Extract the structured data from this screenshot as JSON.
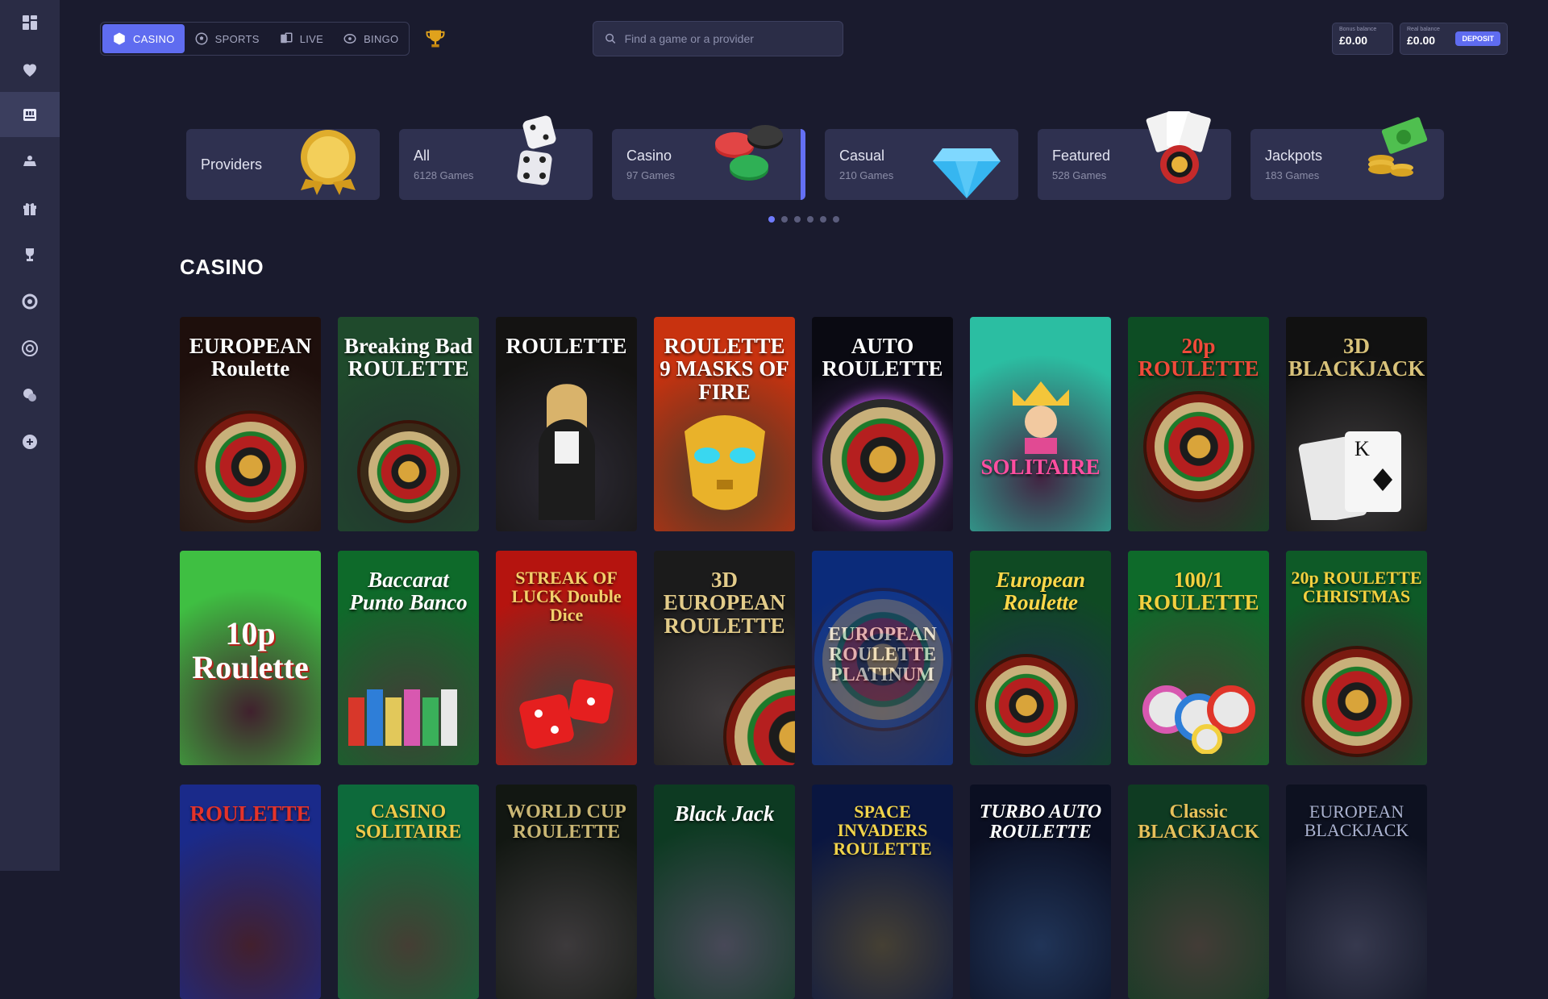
{
  "top_nav": {
    "modes": [
      {
        "label": "CASINO",
        "icon": "cube-icon",
        "active": true
      },
      {
        "label": "SPORTS",
        "icon": "soccer-ball-icon",
        "active": false
      },
      {
        "label": "LIVE",
        "icon": "live-cards-icon",
        "active": false
      },
      {
        "label": "BINGO",
        "icon": "bingo-ball-icon",
        "active": false
      }
    ],
    "trophy_icon": "trophy-icon"
  },
  "search": {
    "placeholder": "Find a game or a provider"
  },
  "balances": {
    "bonus_label": "Bonus balance",
    "bonus_amount": "£0.00",
    "real_label": "Real balance",
    "real_amount": "£0.00",
    "deposit_label": "DEPOSIT"
  },
  "sidebar": {
    "items": [
      {
        "icon": "dashboard-icon"
      },
      {
        "icon": "heart-icon"
      },
      {
        "icon": "casino-icon",
        "active": true
      },
      {
        "icon": "live-dealer-icon"
      },
      {
        "icon": "gift-icon"
      },
      {
        "icon": "trophy-icon"
      },
      {
        "icon": "settings-icon"
      },
      {
        "icon": "roulette-icon"
      },
      {
        "icon": "chat-icon"
      },
      {
        "icon": "support-icon"
      }
    ]
  },
  "categories": [
    {
      "title": "Providers",
      "subtitle": "",
      "icon": "medal-icon"
    },
    {
      "title": "All",
      "subtitle": "6128 Games",
      "icon": "dice-icon"
    },
    {
      "title": "Casino",
      "subtitle": "97 Games",
      "icon": "chips-icon",
      "active": true
    },
    {
      "title": "Casual",
      "subtitle": "210 Games",
      "icon": "diamond-icon"
    },
    {
      "title": "Featured",
      "subtitle": "528 Games",
      "icon": "cards-icon"
    },
    {
      "title": "Jackpots",
      "subtitle": "183 Games",
      "icon": "money-icon"
    }
  ],
  "carousel": {
    "pages": 6,
    "active_page": 1
  },
  "section": {
    "title": "CASINO"
  },
  "games": [
    {
      "name": "EUROPEAN Roulette",
      "bg": "#1e0f0c",
      "accent": "#c9921f"
    },
    {
      "name": "Breaking Bad ROULETTE",
      "bg": "#1f4a2c",
      "accent": "#4f8f3a"
    },
    {
      "name": "ROULETTE",
      "bg": "#141312",
      "accent": "#7a6a52"
    },
    {
      "name": "ROULETTE 9 MASKS OF FIRE",
      "bg": "#c8320f",
      "accent": "#f2b21a"
    },
    {
      "name": "AUTO ROULETTE",
      "bg": "#0a0a12",
      "accent": "#b04adb"
    },
    {
      "name": "SOLITAIRE",
      "bg": "#2bbea2",
      "accent": "#e14a93"
    },
    {
      "name": "20p ROULETTE",
      "bg": "#0d4d24",
      "accent": "#d23326"
    },
    {
      "name": "3D BLACKJACK",
      "bg": "#111111",
      "accent": "#c9b774"
    },
    {
      "name": "10p Roulette",
      "bg": "#3fbf42",
      "accent": "#d8372a"
    },
    {
      "name": "Baccarat Punto Banco",
      "bg": "#0e6a2a",
      "accent": "#e2c85a"
    },
    {
      "name": "STREAK OF LUCK Double Dice",
      "bg": "#b5140f",
      "accent": "#f3d06a"
    },
    {
      "name": "3D EUROPEAN ROULETTE",
      "bg": "#1b1b1b",
      "accent": "#d9c07a"
    },
    {
      "name": "EUROPEAN ROULETTE PLATINUM",
      "bg": "#0b2b7a",
      "accent": "#9fb3ff"
    },
    {
      "name": "European Roulette",
      "bg": "#0f4a23",
      "accent": "#3d66d6"
    },
    {
      "name": "100/1 ROULETTE",
      "bg": "#0e6a2a",
      "accent": "#f2d03f"
    },
    {
      "name": "20p ROULETTE CHRISTMAS",
      "bg": "#0e5a27",
      "accent": "#e0352a"
    },
    {
      "name": "ROULETTE",
      "bg": "#1a2a8a",
      "accent": "#e4332a"
    },
    {
      "name": "CASINO SOLITAIRE",
      "bg": "#0d6a3b",
      "accent": "#f0c94a"
    },
    {
      "name": "WORLD CUP ROULETTE",
      "bg": "#121712",
      "accent": "#c9b674"
    },
    {
      "name": "Black Jack",
      "bg": "#0d3a22",
      "accent": "#ffffff"
    },
    {
      "name": "SPACE INVADERS ROULETTE",
      "bg": "#0a1640",
      "accent": "#f1d34a"
    },
    {
      "name": "TURBO AUTO ROULETTE",
      "bg": "#0b0f22",
      "accent": "#3a9bff"
    },
    {
      "name": "Classic BLACKJACK",
      "bg": "#0f3b22",
      "accent": "#e6c05a"
    },
    {
      "name": "EUROPEAN BLACKJACK",
      "bg": "#0d1120",
      "accent": "#aab2d0"
    }
  ]
}
